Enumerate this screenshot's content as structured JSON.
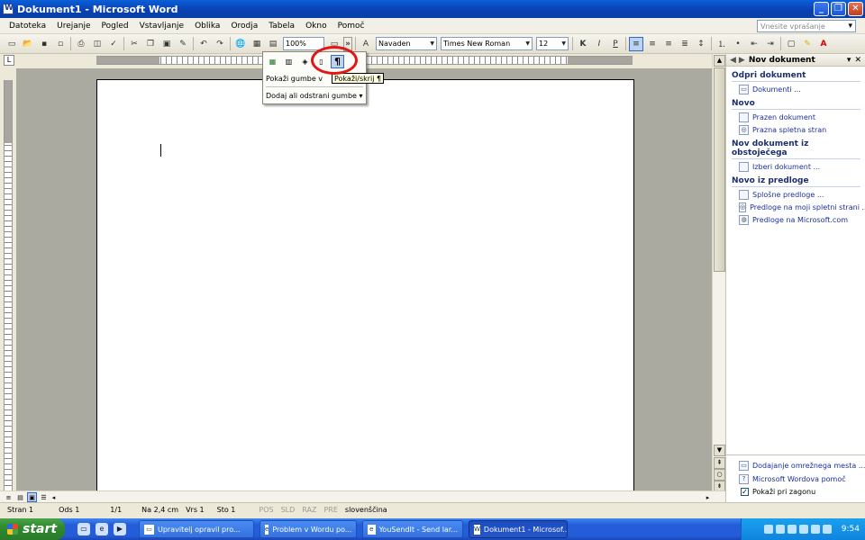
{
  "window": {
    "title": "Dokument1 - Microsoft Word",
    "minimize": "_",
    "maximize": "❐",
    "close": "✕"
  },
  "menu": {
    "items": [
      "Datoteka",
      "Urejanje",
      "Pogled",
      "Vstavljanje",
      "Oblika",
      "Orodja",
      "Tabela",
      "Okno",
      "Pomoč"
    ],
    "help_placeholder": "Vnesite vprašanje"
  },
  "toolbar": {
    "zoom": "100%",
    "style": "Navaden",
    "font": "Times New Roman",
    "size": "12",
    "bold": "K",
    "italic": "I",
    "underline": "P",
    "more": "»"
  },
  "popup": {
    "show_buttons_label": "Pokaži gumbe v",
    "add_remove_label": "Dodaj ali odstrani gumbe",
    "selected_icon_glyph": "¶"
  },
  "tooltip": {
    "text": "Pokaži/skrij ¶"
  },
  "taskpane": {
    "title": "Nov dokument",
    "sections": [
      {
        "title": "Odpri dokument",
        "links": [
          "Dokumenti ..."
        ]
      },
      {
        "title": "Novo",
        "links": [
          "Prazen dokument",
          "Prazna spletna stran"
        ]
      },
      {
        "title": "Nov dokument iz obstoječega",
        "links": [
          "Izberi dokument ..."
        ]
      },
      {
        "title": "Novo iz predloge",
        "links": [
          "Splošne predloge ...",
          "Predloge na moji spletni strani ...",
          "Predloge na Microsoft.com"
        ]
      }
    ],
    "bottom_links": [
      "Dodajanje omrežnega mesta ...",
      "Microsoft Wordova pomoč"
    ],
    "show_at_startup": "Pokaži pri zagonu"
  },
  "status": {
    "page": "Stran 1",
    "section": "Ods 1",
    "pages": "1/1",
    "at": "Na 2,4 cm",
    "line": "Vrs 1",
    "col": "Sto 1",
    "rec": "POS",
    "trk": "SLD",
    "ext": "RAZ",
    "ovr": "PRE",
    "language": "slovenščina"
  },
  "taskbar": {
    "start": "start",
    "tasks": [
      "Upravitelj opravil pro...",
      "Problem v Wordu po...",
      "YouSendIt - Send lar...",
      "Dokument1 - Microsof..."
    ],
    "clock": "9:54"
  }
}
